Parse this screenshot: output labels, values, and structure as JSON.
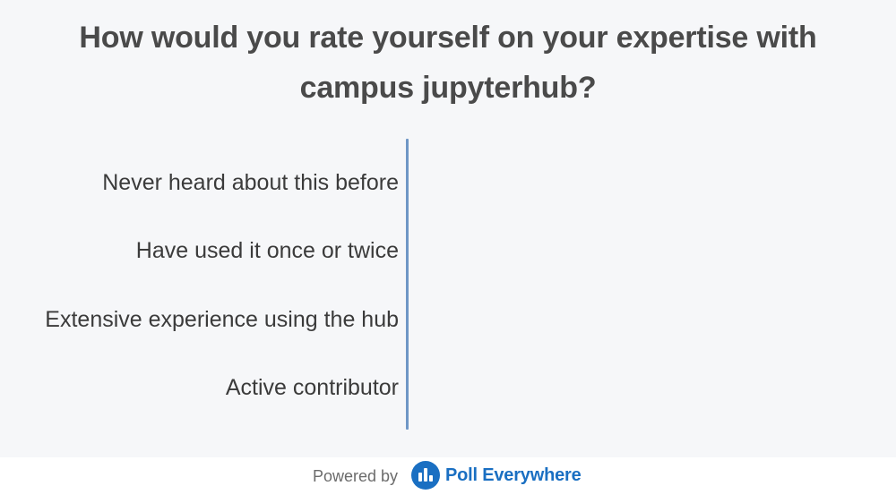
{
  "question": {
    "title": "How would you rate yourself on your expertise with campus jupyterhub?"
  },
  "options": [
    {
      "label": "Never heard about this before"
    },
    {
      "label": "Have used it once or twice"
    },
    {
      "label": "Extensive experience using the hub"
    },
    {
      "label": "Active contributor"
    }
  ],
  "footer": {
    "powered_by": "Powered by",
    "brand": "Poll Everywhere",
    "logo_icon": "poll-everywhere-logo-icon"
  },
  "colors": {
    "axis": "#6f97c6",
    "brand": "#1a6fc2",
    "background": "#f6f7f9"
  }
}
